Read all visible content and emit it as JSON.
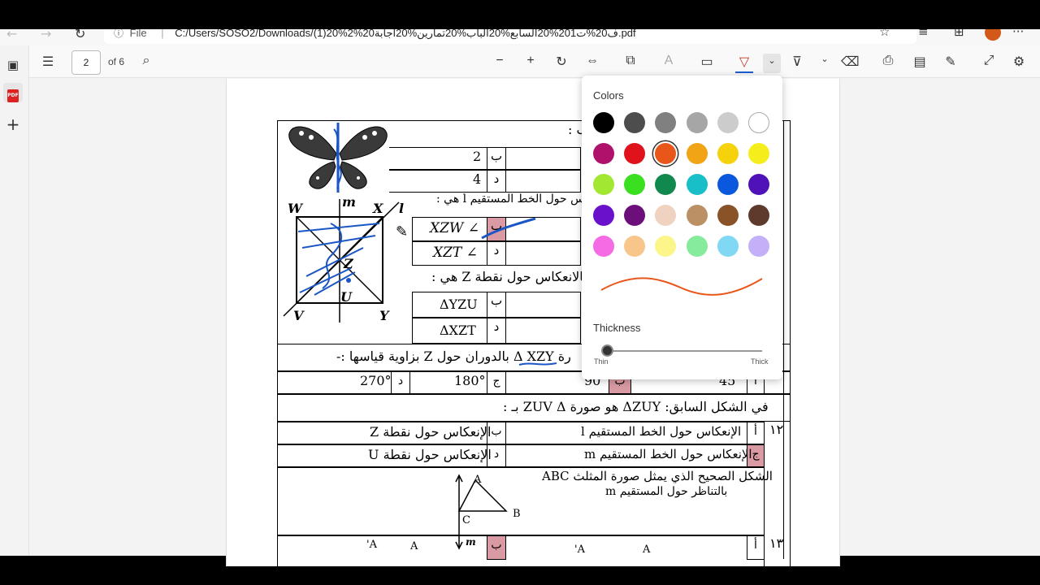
{
  "browser": {
    "file_label": "File",
    "path": "C:/Users/SOSO2/Downloads/(1)20%2%20ف20%ت201%20السابع%20الباب%20تمارين%20اجابة.pdf"
  },
  "pdf_toolbar": {
    "page_number": "2",
    "page_count_label": "of 6"
  },
  "draw_panel": {
    "colors_label": "Colors",
    "thickness_label": "Thickness",
    "thin_label": "Thin",
    "thick_label": "Thick",
    "selected_color": "#e8561a",
    "colors": [
      "#000000",
      "#4d4d4d",
      "#808080",
      "#a6a6a6",
      "#cccccc",
      "#ffffff",
      "#b0126b",
      "#e0121c",
      "#e8561a",
      "#f0a416",
      "#f6d20c",
      "#f6ee1c",
      "#a2e832",
      "#3ae020",
      "#11894e",
      "#19bfc8",
      "#0b58de",
      "#4e12b8",
      "#6a11cc",
      "#6d0f7a",
      "#f0d2c0",
      "#bb9064",
      "#8a5228",
      "#5e3a2c",
      "#f46be4",
      "#f8c68a",
      "#fbf58a",
      "#86ec9c",
      "#80d8f4",
      "#c4b0f8"
    ]
  },
  "document": {
    "lines": {
      "q_prefix": "ب :",
      "opt_b_2": "2",
      "opt_d_4": "4",
      "ref_line_q": "لإنعكاس حول الخط المستقيم l هي :",
      "xzw": "∠ XZW",
      "xzt": "∠ XZT",
      "point_q": "بالانعكاس حول نقطة Z هي :",
      "yzu": "ΔYZU",
      "xzt_tri": "ΔXZT",
      "rotation_q": "رة Δ XZY بالدوران حول Z بزاوية قياسها :-",
      "deg270": "270°",
      "deg180": "180°",
      "deg90": "90",
      "deg45": "45",
      "q_zuy": "في الشكل السابق: ΔZUY هو صورة ZUV Δ بـ :",
      "q12": "١٢",
      "opt_a_line_l": "الإنعكاس حول الخط المستقيم l",
      "opt_b_point_z": "الإنعكاس حول نقطة Z",
      "opt_c_line_m": "الإنعكاس حول الخط المستقيم m",
      "opt_d_point_u": "الإنعكاس حول نقطة U",
      "q_abc_1": "الشكل الصحيح الذي يمثل صورة المثلث  ABC",
      "q_abc_2": "بالتناظر حول المستقيم m",
      "q13": "١٣",
      "letter_a": "أ",
      "letter_b": "ب",
      "letter_c": "ج",
      "letter_d": "د"
    },
    "figure_labels": {
      "W": "W",
      "X": "X",
      "V": "V",
      "Y": "Y",
      "Z": "Z",
      "U": "U",
      "m": "m",
      "l": "l",
      "A": "A",
      "B": "B",
      "C": "C",
      "A_prime": "A'"
    }
  }
}
